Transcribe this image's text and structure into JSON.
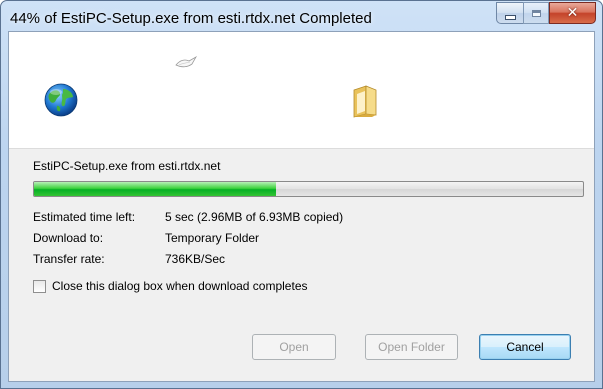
{
  "window": {
    "title": "44% of EstiPC-Setup.exe from esti.rtdx.net Completed",
    "caption_buttons": {
      "minimize_icon": "minimize-icon",
      "maximize_icon": "maximize-icon",
      "close_icon": "close-icon",
      "close_glyph": "✕"
    }
  },
  "animation": {
    "source_icon": "globe-icon",
    "transfer_icon": "flying-page-icon",
    "destination_icon": "folder-icon"
  },
  "download": {
    "filename_source": "EstiPC-Setup.exe from esti.rtdx.net",
    "progress_percent": 44,
    "progress_color": "#06b025"
  },
  "details": {
    "estimated_label": "Estimated time left:",
    "estimated_value": "5 sec (2.96MB of 6.93MB copied)",
    "download_to_label": "Download to:",
    "download_to_value": "Temporary Folder",
    "transfer_rate_label": "Transfer rate:",
    "transfer_rate_value": "736KB/Sec"
  },
  "options": {
    "close_when_done_label": "Close this dialog box when download completes",
    "close_when_done_checked": false
  },
  "buttons": {
    "open": "Open",
    "open_folder": "Open Folder",
    "cancel": "Cancel"
  }
}
